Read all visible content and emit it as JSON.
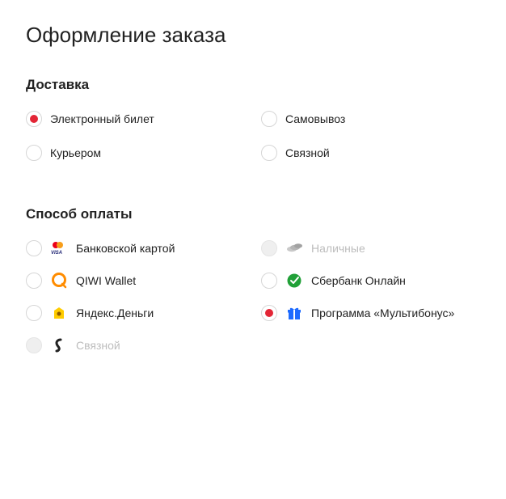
{
  "page": {
    "title": "Оформление заказа"
  },
  "delivery": {
    "title": "Доставка",
    "options": [
      {
        "label": "Электронный билет",
        "selected": true
      },
      {
        "label": "Самовывоз",
        "selected": false
      },
      {
        "label": "Курьером",
        "selected": false
      },
      {
        "label": "Связной",
        "selected": false
      }
    ]
  },
  "payment": {
    "title": "Способ оплаты",
    "options": [
      {
        "label": "Банковской картой",
        "icon": "card-icon",
        "selected": false,
        "disabled": false
      },
      {
        "label": "Наличные",
        "icon": "cash-icon",
        "selected": false,
        "disabled": true
      },
      {
        "label": "QIWI Wallet",
        "icon": "qiwi-icon",
        "selected": false,
        "disabled": false
      },
      {
        "label": "Сбербанк Онлайн",
        "icon": "sberbank-icon",
        "selected": false,
        "disabled": false
      },
      {
        "label": "Яндекс.Деньги",
        "icon": "yandex-money-icon",
        "selected": false,
        "disabled": false
      },
      {
        "label": "Программа «Мультибонус»",
        "icon": "multibonus-icon",
        "selected": true,
        "disabled": false
      },
      {
        "label": "Связной",
        "icon": "svyaznoy-icon",
        "selected": false,
        "disabled": true
      }
    ]
  }
}
